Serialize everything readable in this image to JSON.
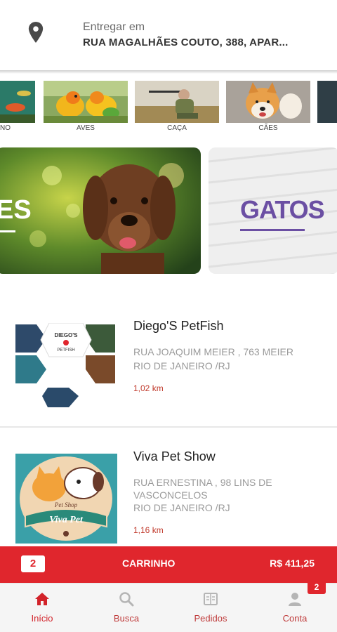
{
  "header": {
    "deliver_label": "Entregar em",
    "deliver_address": "RUA MAGALHÃES COUTO, 388, APAR..."
  },
  "categories": [
    {
      "label": "NO"
    },
    {
      "label": "AVES"
    },
    {
      "label": "CAÇA"
    },
    {
      "label": "CÃES"
    }
  ],
  "banners": {
    "left_text": "ES",
    "right_text": "GATOS"
  },
  "stores": [
    {
      "name": "Diego'S PetFish",
      "address_line1": "RUA JOAQUIM MEIER , 763 MEIER",
      "address_line2": "RIO DE JANEIRO /RJ",
      "distance": "1,02 km",
      "logo_title": "DIEGO'S",
      "logo_subtitle": "PETFISH"
    },
    {
      "name": "Viva Pet Show",
      "address_line1": "RUA ERNESTINA , 98 LINS DE",
      "address_line2": "VASCONCELOS",
      "address_line3": "RIO DE JANEIRO /RJ",
      "distance": "1,16 km",
      "logo_title": "Pet Shop",
      "logo_subtitle": "Viva Pet"
    }
  ],
  "cart": {
    "count": "2",
    "label": "CARRINHO",
    "total": "R$ 411,25"
  },
  "nav": {
    "items": [
      {
        "label": "Início",
        "icon": "home-icon"
      },
      {
        "label": "Busca",
        "icon": "search-icon"
      },
      {
        "label": "Pedidos",
        "icon": "orders-icon"
      },
      {
        "label": "Conta",
        "icon": "user-icon"
      }
    ],
    "account_badge": "2"
  },
  "colors": {
    "brand_red": "#e0262d",
    "accent_purple": "#6b4fa3"
  }
}
